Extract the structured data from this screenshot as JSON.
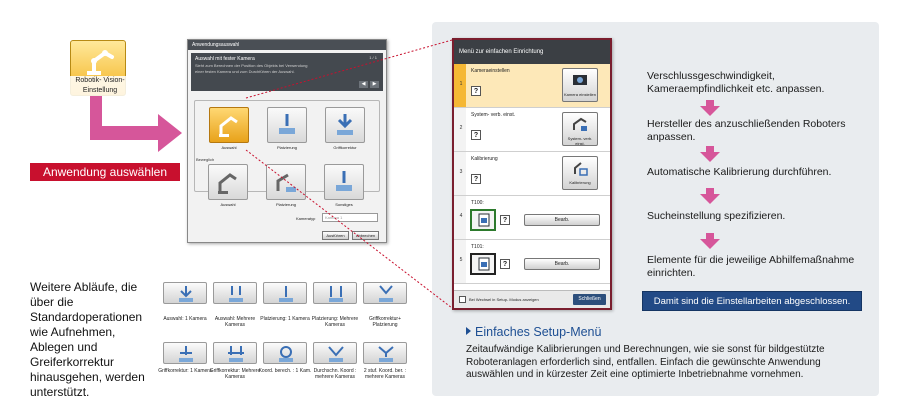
{
  "app_tile": {
    "label": "Robotik- Vision- Einstellung"
  },
  "banner": {
    "label": "Anwendung auswählen"
  },
  "dialog": {
    "title": "Anwendungsauswahl",
    "heading": "Auswahl mit fester Kamera",
    "description": "Sieht zum Berechnen der Position des Objekts bei Verwendung einer festen Kamera und zum Durchführen der Auswahl.",
    "page": "1 / 1",
    "icons_top": [
      "Auswahl",
      "Platzierung",
      "Griffkorrektur"
    ],
    "group_label": "Beweglich",
    "icons_bottom": [
      "Auswahl",
      "Platzierung",
      "Sonstiges"
    ],
    "camera_label": "Kameratyp",
    "camera_value": "Kamera 1",
    "execute_button": "Ausführen",
    "cancel_button": "Abbrechen"
  },
  "more_ops": {
    "text": "Weitere Abläufe, die über die Standardoperationen wie Aufnehmen, Ablegen und Greiferkorrektur hinausgehen, werden unterstützt.",
    "labels": [
      "Auswahl: 1 Kamera",
      "Auswahl: Mehrere Kameras",
      "Platzierung: 1 Kamera",
      "Platzierung: Mehrere Kameras",
      "Griffkorrektur+ Platzierung",
      "Griffkorrektur: 1 Kamera",
      "Griffkorrektur: Mehrere Kameras",
      "Koord. berech. : 1 Kam.",
      "Durchschn. Koord : mehrere Kameras",
      "2 stuf. Koord. ber. : mehrere Kameras"
    ]
  },
  "menu": {
    "title": "Menü zur einfachen Einrichtung",
    "rows": [
      {
        "num": "1",
        "label": "Kameraeinstellen",
        "button": "Kamera einstellen"
      },
      {
        "num": "2",
        "label": "System- verb. einst.",
        "button": "System- verb. einst."
      },
      {
        "num": "3",
        "label": "Kalibrierung",
        "button": "Kalibrierung"
      },
      {
        "num": "4",
        "label": "T100:",
        "button": "Bearb."
      },
      {
        "num": "5",
        "label": "T101:",
        "button": "Bearb."
      }
    ],
    "footer_check": "Bei Wechsel in Setup- Modus anzeigen",
    "close_button": "Schließen"
  },
  "steps": [
    "Verschlussgeschwindigkeit, Kameraempfindlichkeit etc. anpassen.",
    "Hersteller des anzuschließenden Roboters anpassen.",
    "Automatische Kalibrierung durchführen.",
    "Sucheinstellung spezifizieren.",
    "Elemente für die jeweilige Abhilfemaßnahme einrichten."
  ],
  "done_label": "Damit sind die Einstellarbeiten abgeschlossen.",
  "setup_menu": {
    "title": "Einfaches Setup-Menü",
    "description": "Zeitaufwändige Kalibrierungen und Berechnungen, wie sie sonst für bildgestützte Roboteranlagen erforderlich sind, entfallen. Einfach die gewünschte Anwendung auswählen und in kürzester Zeit eine optimierte Inbetriebnahme vornehmen."
  },
  "colors": {
    "accent_red": "#c8102e",
    "pink_arrow": "#d6569a",
    "navy": "#224a86",
    "title_blue": "#1e4f93"
  }
}
